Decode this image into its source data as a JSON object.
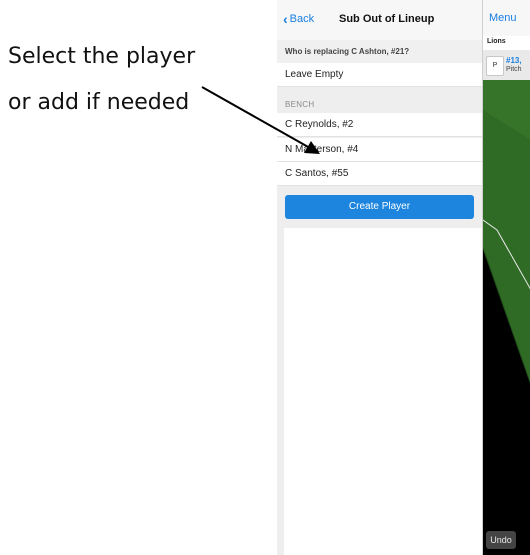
{
  "annotation": {
    "line1": "Select the player",
    "line2": "or add if needed"
  },
  "panel": {
    "back_label": "Back",
    "title": "Sub Out of Lineup",
    "question": "Who is replacing C Ashton, #21?",
    "leave_empty": "Leave Empty",
    "bench_header": "BENCH",
    "bench": [
      {
        "name": "C Reynolds, #2"
      },
      {
        "name": "N Masterson, #4"
      },
      {
        "name": "C Santos, #55"
      }
    ],
    "create_label": "Create Player"
  },
  "game": {
    "menu_label": "Menu",
    "team": "Lions",
    "position": "P",
    "player_number": "#13,",
    "player_role": "Pitch",
    "undo_label": "Undo"
  },
  "colors": {
    "accent": "#1d85de",
    "field_grass": "#2f6b25",
    "field_background": "#000000"
  }
}
